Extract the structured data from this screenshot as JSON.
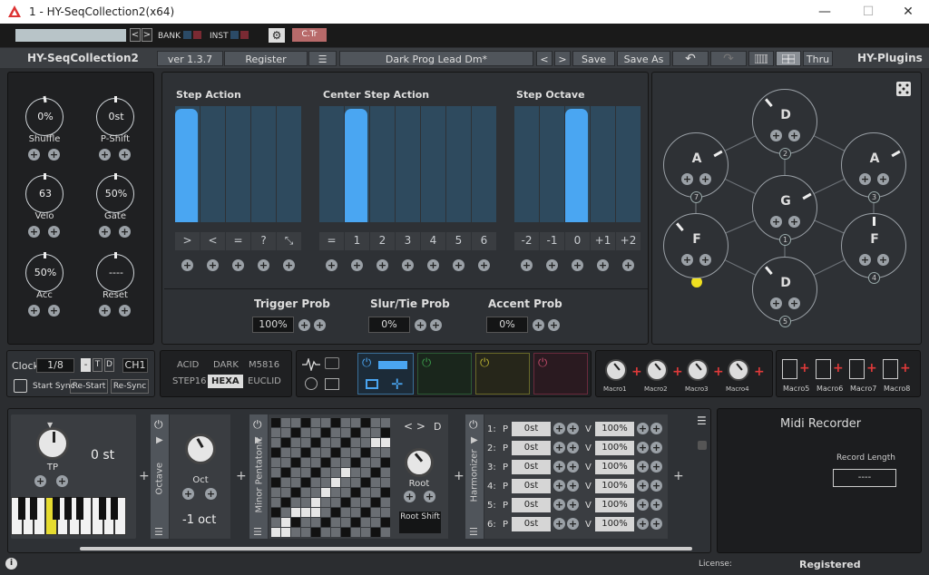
{
  "window": {
    "title": "1 - HY-SeqCollection2(x64)",
    "min": "—",
    "max": "☐",
    "close": "✕"
  },
  "host": {
    "bank": "BANK",
    "inst": "INST",
    "ctr": "C.Tr",
    "left": "<",
    "right": ">",
    "gear": "⚙"
  },
  "header": {
    "plugin_name": "HY-SeqCollection2",
    "version": "ver 1.3.7",
    "register": "Register",
    "menu": "☰",
    "preset": "Dark Prog Lead  Dm*",
    "prev": "<",
    "next": ">",
    "save": "Save",
    "save_as": "Save As",
    "undo": "↶",
    "redo": "↷",
    "thru": "Thru",
    "brand": "HY-Plugins"
  },
  "left_knobs": [
    {
      "value": "0%",
      "label": "Shuffle"
    },
    {
      "value": "0st",
      "label": "P-Shift"
    },
    {
      "value": "63",
      "label": "Velo"
    },
    {
      "value": "50%",
      "label": "Gate"
    },
    {
      "value": "50%",
      "label": "Acc"
    },
    {
      "value": "----",
      "label": "Reset"
    }
  ],
  "step_action": {
    "title": "Step Action",
    "buttons": [
      ">",
      "<",
      "=",
      "?",
      "⤡"
    ]
  },
  "center_step_action": {
    "title": "Center Step Action",
    "buttons": [
      "=",
      "1",
      "2",
      "3",
      "4",
      "5",
      "6"
    ]
  },
  "step_octave": {
    "title": "Step Octave",
    "buttons": [
      "-2",
      "-1",
      "0",
      "+1",
      "+2"
    ]
  },
  "probs": [
    {
      "label": "Trigger Prob",
      "value": "100%"
    },
    {
      "label": "Slur/Tie Prob",
      "value": "0%"
    },
    {
      "label": "Accent Prob",
      "value": "0%"
    }
  ],
  "hex": {
    "nodes": [
      {
        "note": "D",
        "num": "2"
      },
      {
        "note": "A",
        "num": "7"
      },
      {
        "note": "A",
        "num": "3"
      },
      {
        "note": "G",
        "num": "1"
      },
      {
        "note": "F",
        "num": ""
      },
      {
        "note": "F",
        "num": "4"
      },
      {
        "note": "D",
        "num": "5"
      }
    ]
  },
  "clock": {
    "label": "Clock",
    "value": "1/8",
    "minus": "-",
    "t": "T",
    "d": "D",
    "channel": "CH1",
    "start_sync": "Start Sync",
    "restart": "Re-Start",
    "resync": "Re-Sync"
  },
  "modes": {
    "row1": [
      "ACID",
      "DARK",
      "M5816"
    ],
    "row2": [
      "STEP16",
      "HEXA",
      "EUCLID"
    ],
    "active": "HEXA"
  },
  "macros": [
    "Macro1",
    "Macro2",
    "Macro3",
    "Macro4",
    "Macro5",
    "Macro6",
    "Macro7",
    "Macro8"
  ],
  "transpose": {
    "label": "TP",
    "value": "0 st"
  },
  "octave": {
    "side": "Octave",
    "label": "Oct",
    "value": "-1 oct"
  },
  "scale": {
    "side": "Minor Pentatonic",
    "root_label": "Root",
    "root_note": "D",
    "root_shift": "Root Shift",
    "nav": "< >"
  },
  "harmonizer": {
    "side": "Harmonizer",
    "rows": [
      {
        "n": "1:",
        "p": "P",
        "pitch": "0st",
        "v": "V",
        "vel": "100%"
      },
      {
        "n": "2:",
        "p": "P",
        "pitch": "0st",
        "v": "V",
        "vel": "100%"
      },
      {
        "n": "3:",
        "p": "P",
        "pitch": "0st",
        "v": "V",
        "vel": "100%"
      },
      {
        "n": "4:",
        "p": "P",
        "pitch": "0st",
        "v": "V",
        "vel": "100%"
      },
      {
        "n": "5:",
        "p": "P",
        "pitch": "0st",
        "v": "V",
        "vel": "100%"
      },
      {
        "n": "6:",
        "p": "P",
        "pitch": "0st",
        "v": "V",
        "vel": "100%"
      }
    ]
  },
  "midi_recorder": {
    "title": "Midi Recorder",
    "length_label": "Record Length",
    "length_value": "----"
  },
  "footer": {
    "info": "i",
    "license": "License:",
    "registered": "Registered"
  },
  "colors": {
    "accent": "#4aa6f2",
    "red": "#e03a3a",
    "yellow": "#f0e020"
  }
}
